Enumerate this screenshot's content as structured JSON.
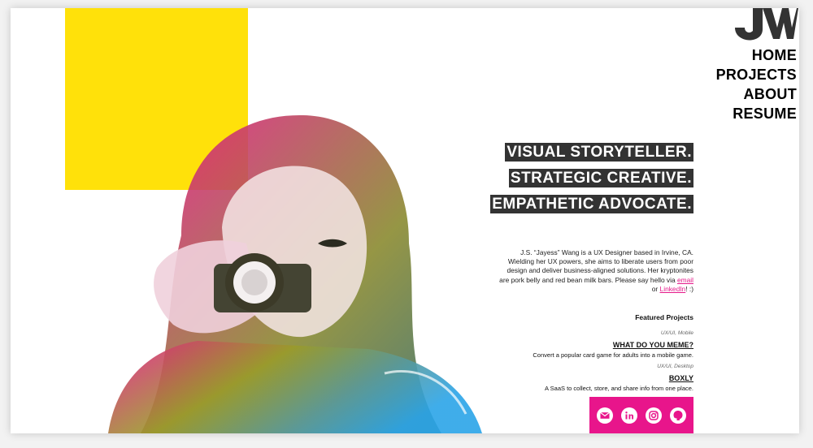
{
  "nav": {
    "items": [
      {
        "label": "HOME"
      },
      {
        "label": "PROJECTS"
      },
      {
        "label": "ABOUT"
      },
      {
        "label": "RESUME"
      }
    ]
  },
  "hero": {
    "taglines": [
      "VISUAL STORYTELLER.",
      "STRATEGIC CREATIVE.",
      "EMPATHETIC ADVOCATE."
    ]
  },
  "bio": {
    "text": "J.S. “Jayess” Wang is a UX Designer based in Irvine, CA. Wielding her UX powers, she aims to liberate users from poor design and deliver business-aligned solutions. Her kryptonites are pork belly and red bean milk bars. Please say hello via",
    "email_label": "email",
    "or_text": "or",
    "linkedin_label": "LinkedIn",
    "end_text": "! :)"
  },
  "featured": {
    "heading": "Featured Projects",
    "projects": [
      {
        "category": "UX/UI, Mobile",
        "title": "WHAT DO YOU MEME?",
        "description": "Convert a popular card game for adults into a mobile game."
      },
      {
        "category": "UX/UI, Desktop",
        "title": "BOXLY",
        "description": "A SaaS to collect, store, and share info from one place."
      }
    ]
  },
  "social": {
    "icons": [
      "email-icon",
      "linkedin-icon",
      "instagram-icon",
      "github-icon"
    ]
  },
  "colors": {
    "accent_yellow": "#ffe10a",
    "accent_pink": "#e8158b",
    "tag_bg": "#333333"
  }
}
